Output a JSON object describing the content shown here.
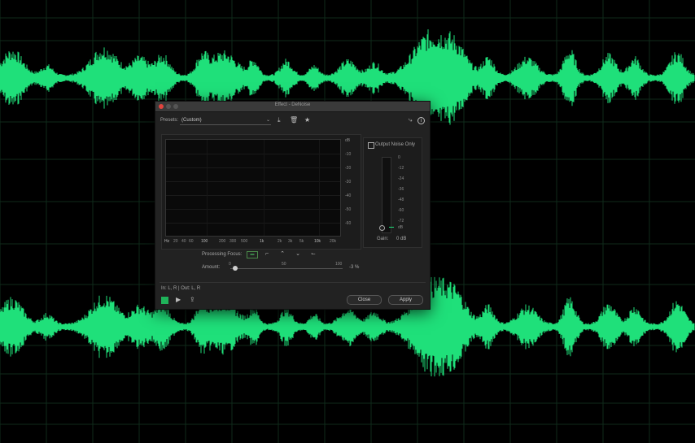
{
  "dialog": {
    "title": "Effect - DeNoise",
    "presets_label": "Presets:",
    "preset_value": "(Custom)",
    "output_noise_only_label": "Output Noise Only",
    "processing_focus_label": "Processing Focus:",
    "amount_label": "Amount:",
    "amount_min": "0",
    "amount_mid": "50",
    "amount_max": "100",
    "amount_value": "-3 %",
    "gain_label": "Gain:",
    "gain_value": "0 dB",
    "io_label": "In: L, R | Out: L, R",
    "close_label": "Close",
    "apply_label": "Apply",
    "db_axis": [
      "dB",
      "-10",
      "-20",
      "-30",
      "-40",
      "-50",
      "-60"
    ],
    "hz_axis": [
      "Hz",
      "20",
      "40",
      "60",
      "100",
      "200",
      "300",
      "500",
      "1k",
      "2k",
      "3k",
      "5k",
      "10k",
      "20k"
    ],
    "meter_ticks": [
      "0",
      "-12",
      "-24",
      "-36",
      "-48",
      "-60",
      "-72",
      "dB"
    ]
  },
  "colors": {
    "waveform": "#1fe07a",
    "accent": "#1fb35a"
  }
}
